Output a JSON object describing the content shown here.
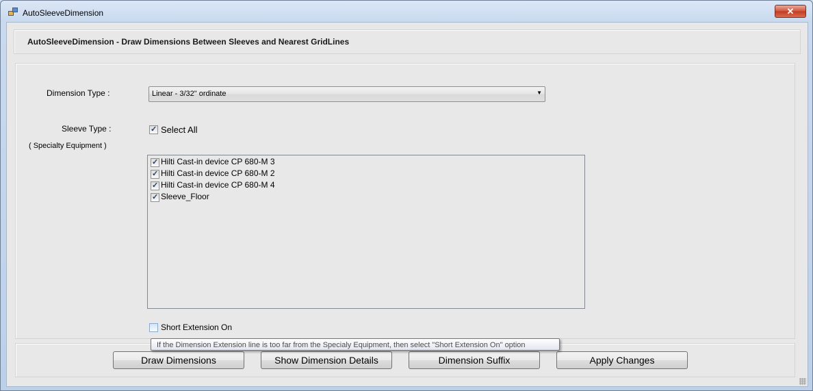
{
  "window": {
    "title": "AutoSleeveDimension",
    "close_label": "✕"
  },
  "header": {
    "text": "AutoSleeveDimension - Draw Dimensions Between Sleeves and Nearest GridLines"
  },
  "dimension_type": {
    "label": "Dimension Type :",
    "selected": "Linear - 3/32\" ordinate"
  },
  "sleeve_type": {
    "label": "Sleeve Type :",
    "sublabel": "( Specialty Equipment )",
    "select_all_label": "Select All",
    "select_all_checked": true,
    "items": [
      {
        "label": "Hilti Cast-in device CP 680-M 3",
        "checked": true
      },
      {
        "label": "Hilti Cast-in device CP 680-M 2",
        "checked": true
      },
      {
        "label": "Hilti Cast-in device CP 680-M 4",
        "checked": true
      },
      {
        "label": "Sleeve_Floor",
        "checked": true
      }
    ]
  },
  "short_extension": {
    "label": "Short Extension On",
    "checked": false
  },
  "tooltip": {
    "text": "If the Dimension Extension line is too far from the Specialy Equipment, then select \"Short Extension On\" option"
  },
  "buttons": {
    "draw": "Draw Dimensions",
    "details": "Show Dimension Details",
    "suffix": "Dimension Suffix",
    "apply": "Apply Changes"
  },
  "icons": {
    "checkmark": "check-icon",
    "dropdown": "chevron-down-icon",
    "app": "app-icon"
  }
}
